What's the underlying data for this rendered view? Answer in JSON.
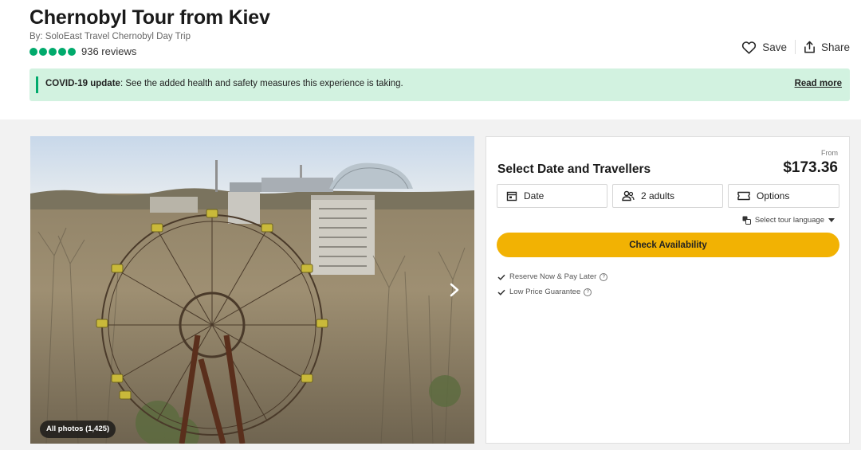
{
  "header": {
    "title": "Chernobyl Tour from Kiev",
    "byline": "By: SoloEast Travel Chernobyl Day Trip",
    "rating_bubbles": 5,
    "reviews": "936 reviews",
    "save_label": "Save",
    "share_label": "Share"
  },
  "covid": {
    "label": "COVID-19 update",
    "message": ": See the added health and safety measures this experience is taking.",
    "link": "Read more"
  },
  "gallery": {
    "all_photos": "All photos (1,425)"
  },
  "booking": {
    "title": "Select Date and Travellers",
    "from_label": "From",
    "price": "$173.36",
    "date_label": "Date",
    "travellers_label": "2 adults",
    "options_label": "Options",
    "language_label": "Select tour language",
    "cta": "Check Availability",
    "perks": [
      "Reserve Now & Pay Later",
      "Low Price Guarantee"
    ]
  },
  "colors": {
    "rating_green": "#00aa6c",
    "covid_bg": "#d2f2e0",
    "cta_yellow": "#f2b203"
  }
}
